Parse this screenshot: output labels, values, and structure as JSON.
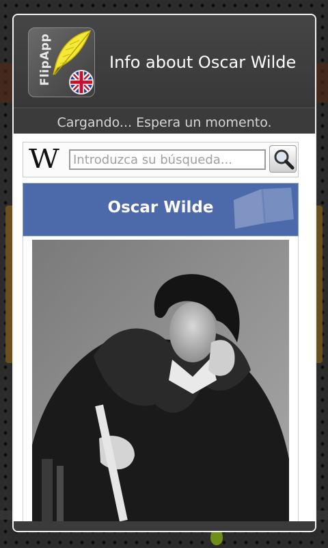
{
  "dialog": {
    "app_brand": "FlipApp",
    "title": "Info about Oscar Wilde",
    "status": "Cargando... Espera un momento."
  },
  "search": {
    "logo": "W",
    "placeholder": "Introduzca su búsqueda...",
    "value": ""
  },
  "article": {
    "title": "Oscar Wilde"
  },
  "icons": {
    "app": "flipapp-feather-icon",
    "flag": "uk-flag-icon",
    "search": "magnifier-icon",
    "book": "open-book-icon"
  },
  "colors": {
    "article_header": "#4c69a9",
    "dialog_border": "#f4f4f4",
    "dialog_header": "#3b3b3b"
  }
}
